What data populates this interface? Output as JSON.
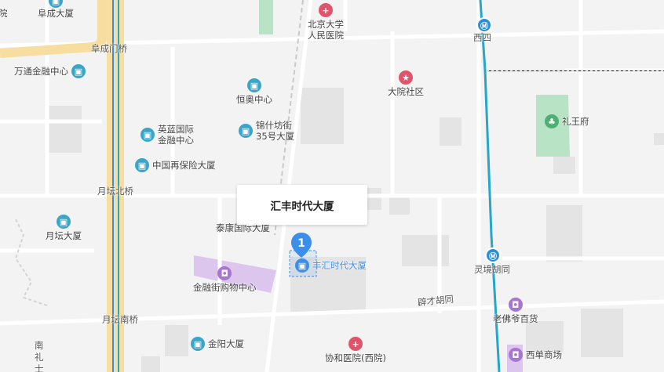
{
  "callout_title": "汇丰时代大厦",
  "marker_number": "1",
  "selected_poi": "丰汇时代大厦",
  "roads": {
    "fuchengmenqiao": "阜成门桥",
    "yuetanbeiqiao": "月坛北桥",
    "yuetannanqiao": "月坛南桥",
    "picai": "辟才胡同",
    "nanlishi": "南\n礼\n士"
  },
  "metro": {
    "xisi": "西四",
    "lingjing": "灵境胡同"
  },
  "pois": {
    "fucheng": "阜成大厦",
    "wantong": "万通金融中心",
    "yinglan": "英蓝国际\n金融中心",
    "zhongguo": "中国再保险大厦",
    "yuetan": "月坛大厦",
    "hengao": "恒奥中心",
    "jinshi": "锦什坊街\n35号大厦",
    "taikang": "泰康国际大厦",
    "jinrongjie": "金融街购物中心",
    "jinyang": "金阳大厦",
    "beida": "北京大学\n人民医院",
    "dayuan": "大院社区",
    "liwang": "礼王府",
    "xiehe": "协和医院(西院)",
    "laofoye": "老佛爷百货",
    "xidan": "西单商场",
    "corner": "院"
  },
  "colors": {
    "background": "#f3f3f3",
    "road": "#ffffff",
    "highway": "#f7dea0",
    "metro_line": "#26a6c9",
    "blue_line": "#3d8ee0",
    "green_area": "#b8e3c4",
    "purple_area": "#dcc6ee",
    "building": "#e2e2e2",
    "marker": "#3b8eea"
  }
}
